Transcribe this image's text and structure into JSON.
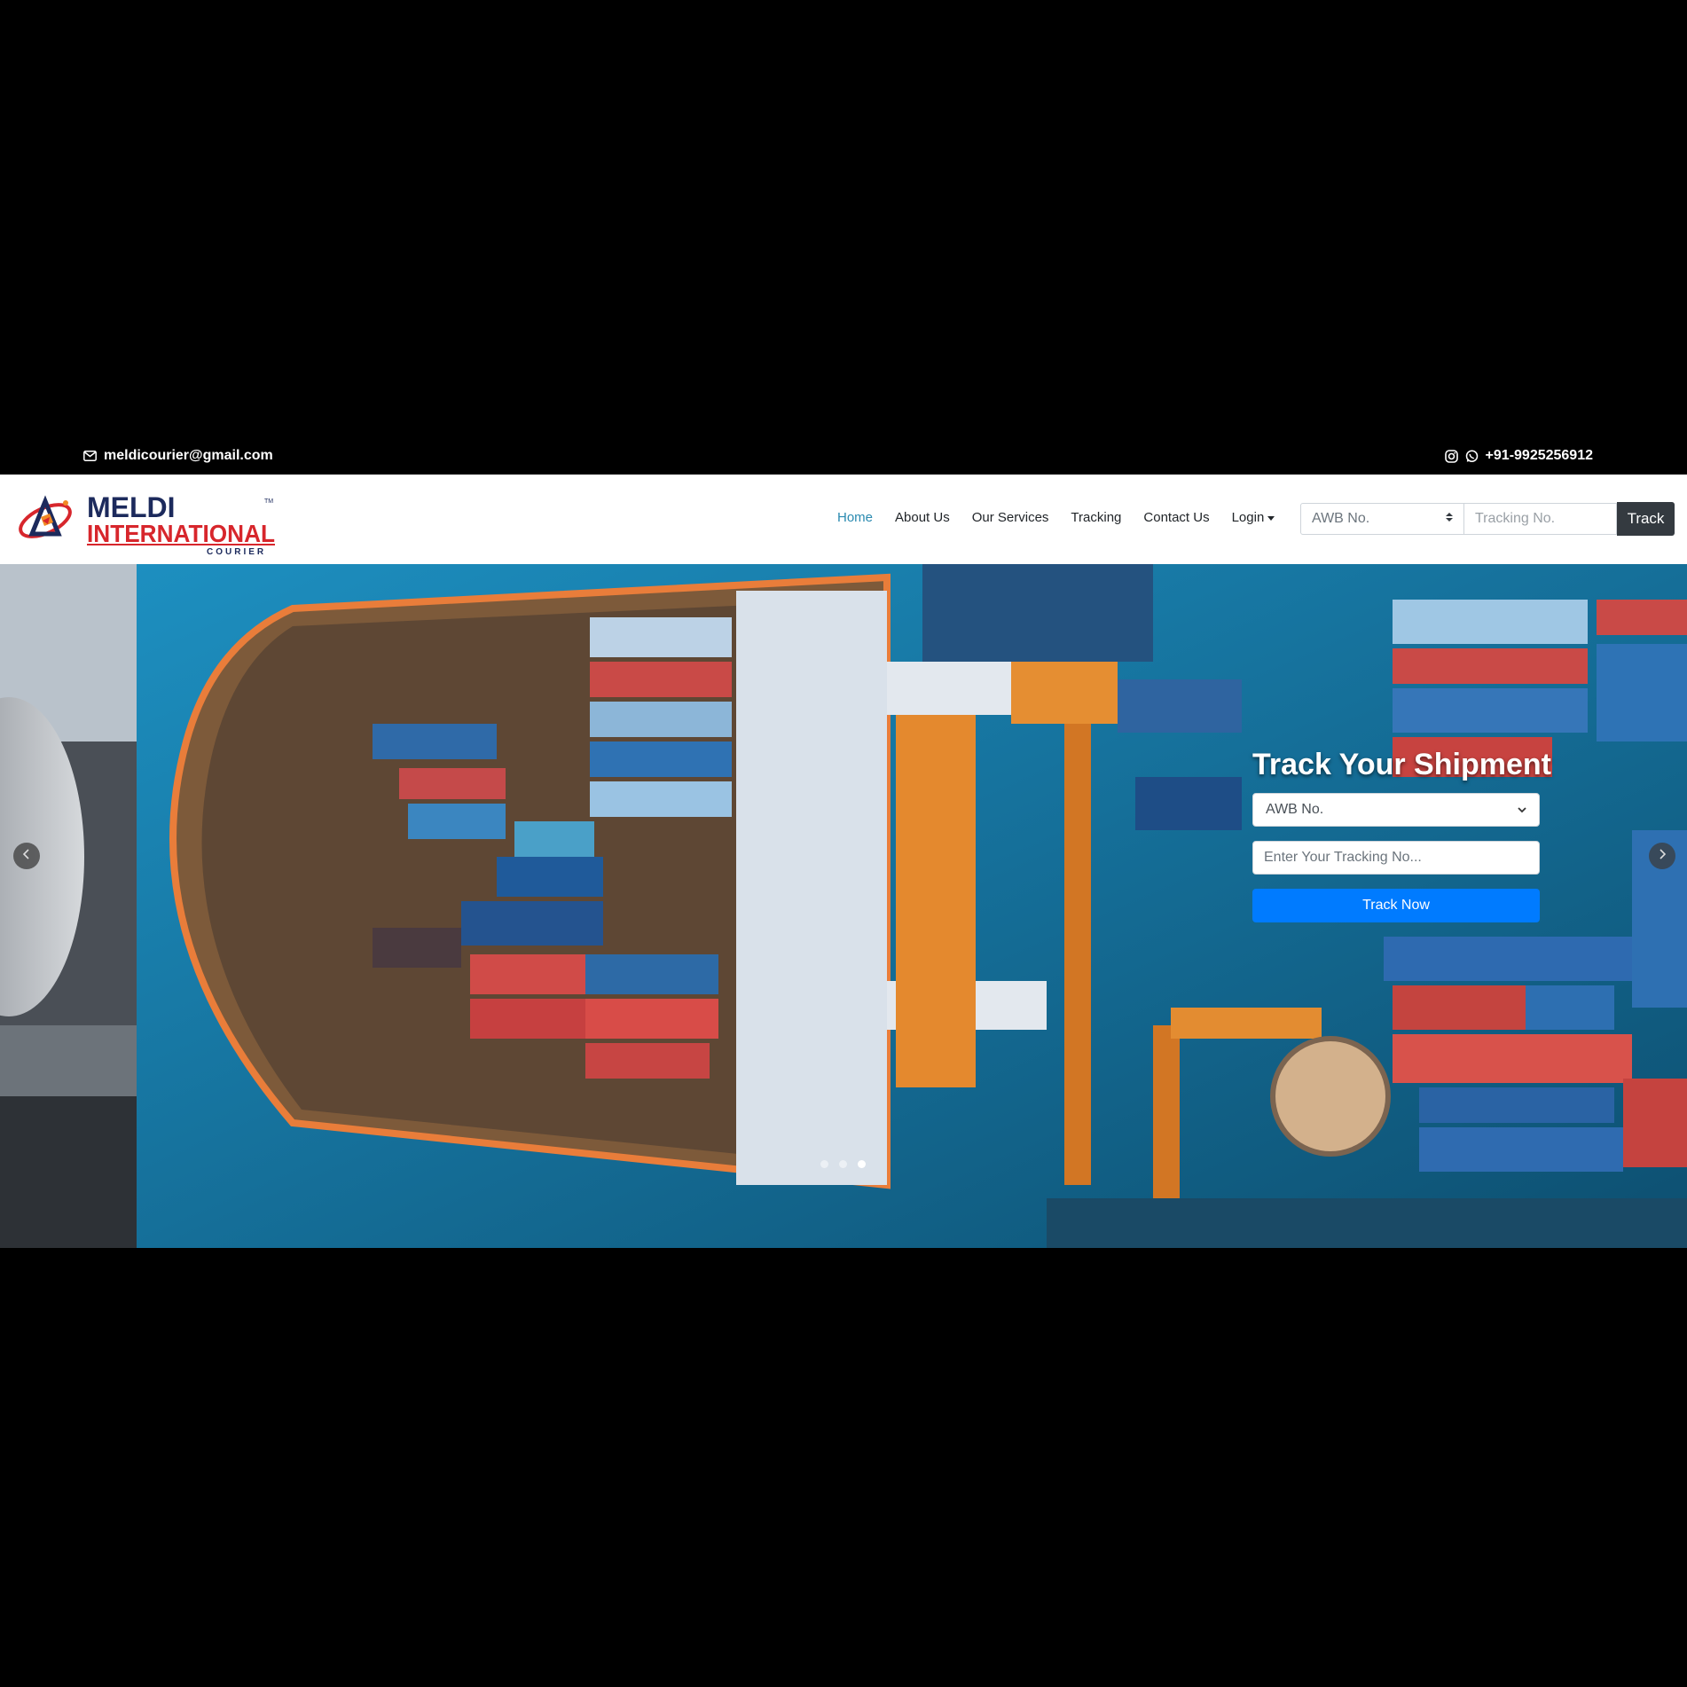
{
  "topbar": {
    "email": "meldicourier@gmail.com",
    "phone": "+91-9925256912",
    "icons": [
      "envelope-icon",
      "instagram-icon",
      "whatsapp-icon"
    ]
  },
  "logo": {
    "line1": "MELDI",
    "line2": "INTERNATIONAL",
    "line3": "COURIER",
    "tm": "TM",
    "colors": {
      "navy": "#1c2a5c",
      "red": "#d7262c",
      "orange": "#f08a24"
    }
  },
  "nav": {
    "items": [
      {
        "label": "Home",
        "active": true
      },
      {
        "label": "About Us"
      },
      {
        "label": "Our Services"
      },
      {
        "label": "Tracking"
      },
      {
        "label": "Contact Us"
      },
      {
        "label": "Login"
      }
    ],
    "search": {
      "select_value": "AWB No.",
      "input_placeholder": "Tracking No.",
      "button_label": "Track"
    }
  },
  "hero": {
    "title": "Track Your Shipment",
    "select_value": "AWB No.",
    "input_placeholder": "Enter Your Tracking No...",
    "button_label": "Track Now",
    "slides": 3,
    "active_slide": 3,
    "prev_icon": "chevron-left-icon",
    "next_icon": "chevron-right-icon"
  },
  "colors": {
    "accent": "#2a8ab0",
    "primary_button": "#007bff",
    "dark_button": "#343a40"
  }
}
